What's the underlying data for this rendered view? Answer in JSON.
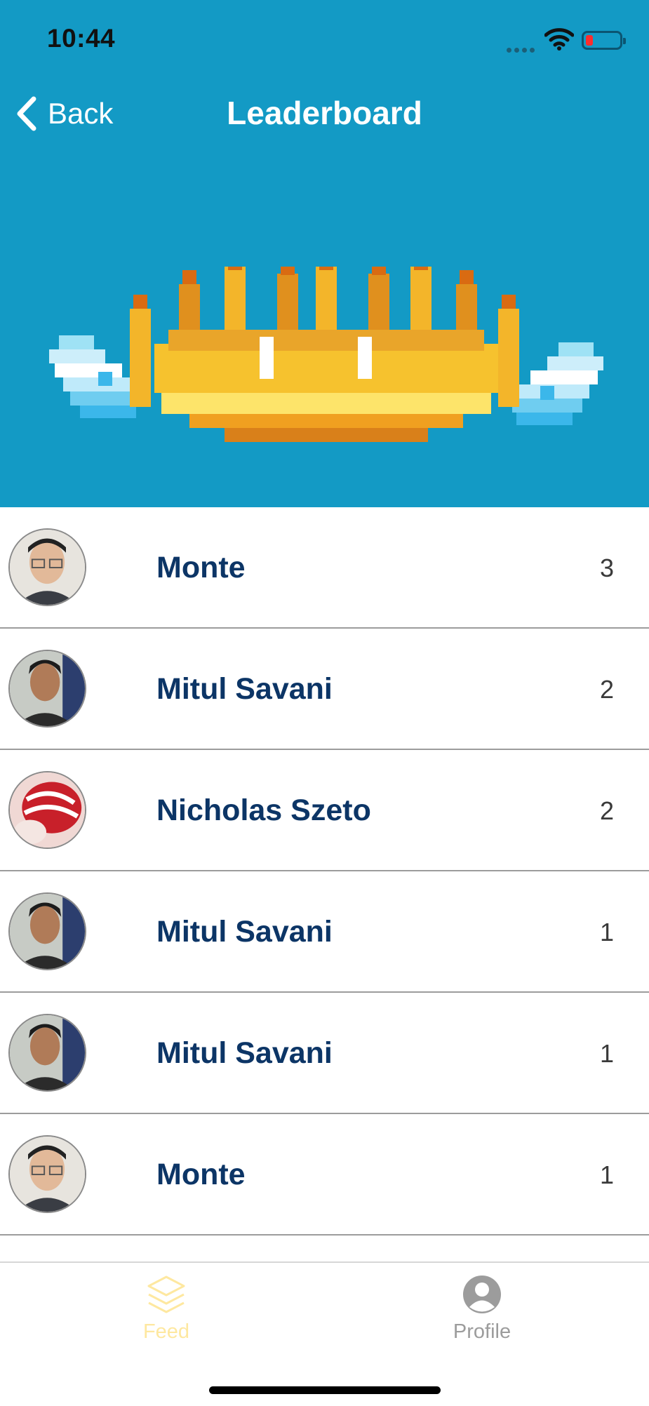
{
  "status_bar": {
    "time": "10:44"
  },
  "nav": {
    "back_label": "Back",
    "title": "Leaderboard"
  },
  "colors": {
    "header_bg": "#139AC5",
    "name_text": "#0C3566",
    "tab_active": "#FEE8A0",
    "tab_inactive": "#9C9C9C"
  },
  "leaderboard": {
    "rows": [
      {
        "name": "Monte",
        "score": "3"
      },
      {
        "name": "Mitul Savani",
        "score": "2"
      },
      {
        "name": "Nicholas Szeto",
        "score": "2"
      },
      {
        "name": "Mitul Savani",
        "score": "1"
      },
      {
        "name": "Mitul Savani",
        "score": "1"
      },
      {
        "name": "Monte",
        "score": "1"
      }
    ]
  },
  "tabs": [
    {
      "label": "Feed",
      "icon": "layers-icon",
      "active": true
    },
    {
      "label": "Profile",
      "icon": "person-icon",
      "active": false
    }
  ]
}
